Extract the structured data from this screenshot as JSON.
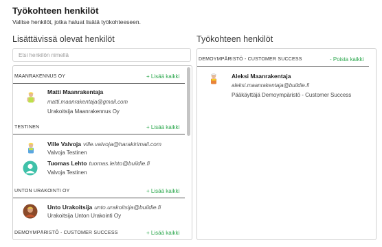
{
  "page": {
    "title": "Työkohteen henkilöt",
    "subtitle": "Valitse henkilöt, jotka haluat lisätä työkohteeseen."
  },
  "left": {
    "title": "Lisättävissä olevat henkilöt",
    "search_placeholder": "Etsi henkilön nimellä",
    "groups": [
      {
        "name": "MAANRAKENNUS OY",
        "action": "+ Lisää kaikki",
        "people": [
          {
            "name": "Matti Maanrakentaja",
            "email": "matti.maanrakentaja@gmail.com",
            "role": "Urakoitsija Maanrakennus Oy"
          }
        ]
      },
      {
        "name": "TESTINEN",
        "action": "+ Lisää kaikki",
        "people": [
          {
            "name": "Ville Valvoja",
            "email": "ville.valvoja@harakirimail.com",
            "role": "Valvoja Testinen"
          },
          {
            "name": "Tuomas Lehto",
            "email": "tuomas.lehto@buildie.fi",
            "role": "Valvoja Testinen"
          }
        ]
      },
      {
        "name": "UNTON URAKOINTI OY",
        "action": "+ Lisää kaikki",
        "people": [
          {
            "name": "Unto Urakoitsija",
            "email": "unto.urakoitsija@buildie.fi",
            "role": "Urakoitsija Unton Urakointi Oy"
          }
        ]
      },
      {
        "name": "DEMOYMPÄRISTÖ - CUSTOMER SUCCESS",
        "action": "+ Lisää kaikki",
        "people": []
      }
    ]
  },
  "right": {
    "title": "Työkohteen henkilöt",
    "groups": [
      {
        "name": "DEMOYMPÄRISTÖ - CUSTOMER SUCCESS",
        "action": "- Poista kaikki",
        "people": [
          {
            "name": "Aleksi Maanrakentaja",
            "email": "aleksi.maanrakentaja@buildie.fi",
            "role": "Pääkäyttäjä Demoympäristö - Customer Success"
          }
        ]
      }
    ]
  },
  "colors": {
    "accent": "#2ea84f",
    "border": "#cfcfcf",
    "divider": "#555555"
  }
}
